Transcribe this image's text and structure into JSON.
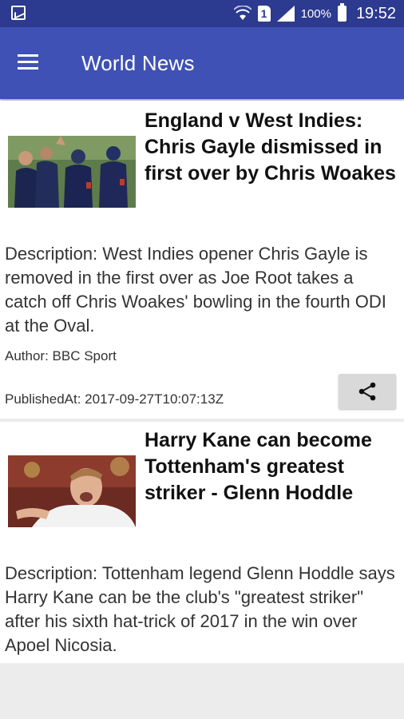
{
  "status_bar": {
    "battery": "100%",
    "time": "19:52",
    "sim": "1"
  },
  "app_bar": {
    "title": "World News"
  },
  "articles": [
    {
      "title": "England v West Indies: Chris Gayle dismissed in first over by Chris Woakes",
      "description": "Description: West Indies opener Chris Gayle is removed in the first over as Joe Root takes a catch off Chris Woakes' bowling in the fourth ODI at the Oval.",
      "author": "Author: BBC Sport",
      "published_at": "PublishedAt: 2017-09-27T10:07:13Z"
    },
    {
      "title": "Harry Kane can become Tottenham's greatest striker - Glenn Hoddle",
      "description": "Description: Tottenham legend Glenn Hoddle says Harry Kane can be the club's \"greatest striker\" after his sixth hat-trick of 2017 in the win over Apoel Nicosia."
    }
  ]
}
